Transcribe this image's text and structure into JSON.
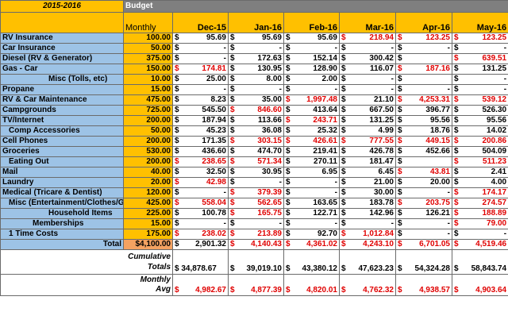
{
  "sheet": {
    "year_label": "2015-2016",
    "budget_label": "Budget",
    "monthly_label": "Monthly",
    "months": [
      "Dec-15",
      "Jan-16",
      "Feb-16",
      "Mar-16",
      "Apr-16",
      "May-16"
    ],
    "colors": {
      "header_yellow": "#ffc000",
      "label_blue": "#9dc3e6",
      "negative_red": "#e00000",
      "total_orange": "#f4a261",
      "budget_grey": "#7f7f7f"
    },
    "rows": [
      {
        "label": "RV Insurance",
        "indent": 0,
        "monthly": "100.00",
        "cells": [
          {
            "v": "95.69",
            "neg": false
          },
          {
            "v": "95.69",
            "neg": false
          },
          {
            "v": "95.69",
            "neg": false
          },
          {
            "v": "218.94",
            "neg": true
          },
          {
            "v": "123.25",
            "neg": true
          },
          {
            "v": "123.25",
            "neg": true
          }
        ]
      },
      {
        "label": "Car Insurance",
        "indent": 0,
        "monthly": "50.00",
        "cells": [
          {
            "v": "-",
            "neg": false
          },
          {
            "v": "-",
            "neg": false
          },
          {
            "v": "-",
            "neg": false
          },
          {
            "v": "-",
            "neg": false
          },
          {
            "v": "-",
            "neg": false
          },
          {
            "v": "-",
            "neg": false
          }
        ]
      },
      {
        "label": "Diesel (RV & Generator)",
        "indent": 0,
        "monthly": "375.00",
        "cells": [
          {
            "v": "-",
            "neg": false
          },
          {
            "v": "172.63",
            "neg": false
          },
          {
            "v": "152.14",
            "neg": false
          },
          {
            "v": "300.42",
            "neg": false
          },
          {
            "v": "",
            "neg": false
          },
          {
            "v": "639.51",
            "neg": true
          }
        ]
      },
      {
        "label": "Gas - Car",
        "indent": 0,
        "monthly": "150.00",
        "cells": [
          {
            "v": "174.81",
            "neg": true
          },
          {
            "v": "130.95",
            "neg": false
          },
          {
            "v": "128.90",
            "neg": false
          },
          {
            "v": "116.07",
            "neg": false
          },
          {
            "v": "187.16",
            "neg": true
          },
          {
            "v": "131.25",
            "neg": false
          }
        ]
      },
      {
        "label": "Misc (Tolls, etc)",
        "indent": 4,
        "monthly": "10.00",
        "cells": [
          {
            "v": "25.00",
            "neg": false
          },
          {
            "v": "8.00",
            "neg": false
          },
          {
            "v": "2.00",
            "neg": false
          },
          {
            "v": "-",
            "neg": false
          },
          {
            "v": "",
            "neg": false
          },
          {
            "v": "-",
            "neg": false
          }
        ]
      },
      {
        "label": "Propane",
        "indent": 0,
        "monthly": "15.00",
        "cells": [
          {
            "v": "-",
            "neg": false
          },
          {
            "v": "-",
            "neg": false
          },
          {
            "v": "-",
            "neg": false
          },
          {
            "v": "-",
            "neg": false
          },
          {
            "v": "-",
            "neg": false
          },
          {
            "v": "-",
            "neg": false
          }
        ]
      },
      {
        "label": "RV & Car Maintenance",
        "indent": 0,
        "monthly": "475.00",
        "cells": [
          {
            "v": "8.23",
            "neg": false
          },
          {
            "v": "35.00",
            "neg": false
          },
          {
            "v": "1,997.48",
            "neg": true
          },
          {
            "v": "21.10",
            "neg": false
          },
          {
            "v": "4,253.31",
            "neg": true
          },
          {
            "v": "539.12",
            "neg": true
          }
        ]
      },
      {
        "label": "Campgrounds",
        "indent": 0,
        "monthly": "725.00",
        "cells": [
          {
            "v": "545.50",
            "neg": false
          },
          {
            "v": "846.60",
            "neg": true
          },
          {
            "v": "413.64",
            "neg": false
          },
          {
            "v": "667.50",
            "neg": false
          },
          {
            "v": "396.77",
            "neg": false
          },
          {
            "v": "526.30",
            "neg": false
          }
        ]
      },
      {
        "label": "TV/Internet",
        "indent": 0,
        "monthly": "200.00",
        "cells": [
          {
            "v": "187.94",
            "neg": false
          },
          {
            "v": "113.66",
            "neg": false
          },
          {
            "v": "243.71",
            "neg": true
          },
          {
            "v": "131.25",
            "neg": false
          },
          {
            "v": "95.56",
            "neg": false
          },
          {
            "v": "95.56",
            "neg": false
          }
        ]
      },
      {
        "label": "Comp Accessories",
        "indent": 1,
        "monthly": "50.00",
        "cells": [
          {
            "v": "45.23",
            "neg": false
          },
          {
            "v": "36.08",
            "neg": false
          },
          {
            "v": "25.32",
            "neg": false
          },
          {
            "v": "4.99",
            "neg": false
          },
          {
            "v": "18.76",
            "neg": false
          },
          {
            "v": "14.02",
            "neg": false
          }
        ]
      },
      {
        "label": "Cell Phones",
        "indent": 0,
        "monthly": "200.00",
        "cells": [
          {
            "v": "171.35",
            "neg": false
          },
          {
            "v": "303.15",
            "neg": true
          },
          {
            "v": "426.61",
            "neg": true
          },
          {
            "v": "777.55",
            "neg": true
          },
          {
            "v": "449.15",
            "neg": true
          },
          {
            "v": "200.86",
            "neg": true
          }
        ]
      },
      {
        "label": "Groceries",
        "indent": 0,
        "monthly": "530.00",
        "cells": [
          {
            "v": "436.60",
            "neg": false
          },
          {
            "v": "474.70",
            "neg": false
          },
          {
            "v": "219.41",
            "neg": false
          },
          {
            "v": "426.78",
            "neg": false
          },
          {
            "v": "452.66",
            "neg": false
          },
          {
            "v": "504.09",
            "neg": false
          }
        ]
      },
      {
        "label": "Eating Out",
        "indent": 1,
        "monthly": "200.00",
        "cells": [
          {
            "v": "238.65",
            "neg": true
          },
          {
            "v": "571.34",
            "neg": true
          },
          {
            "v": "270.11",
            "neg": false
          },
          {
            "v": "181.47",
            "neg": false
          },
          {
            "v": "",
            "neg": false
          },
          {
            "v": "511.23",
            "neg": true
          }
        ]
      },
      {
        "label": "Mail",
        "indent": 0,
        "monthly": "40.00",
        "cells": [
          {
            "v": "32.50",
            "neg": false
          },
          {
            "v": "30.95",
            "neg": false
          },
          {
            "v": "6.95",
            "neg": false
          },
          {
            "v": "6.45",
            "neg": false
          },
          {
            "v": "43.81",
            "neg": true
          },
          {
            "v": "2.41",
            "neg": false
          }
        ]
      },
      {
        "label": "Laundry",
        "indent": 0,
        "monthly": "20.00",
        "cells": [
          {
            "v": "42.98",
            "neg": true
          },
          {
            "v": "-",
            "neg": false
          },
          {
            "v": "-",
            "neg": false
          },
          {
            "v": "21.00",
            "neg": false
          },
          {
            "v": "20.00",
            "neg": false
          },
          {
            "v": "4.00",
            "neg": false
          }
        ]
      },
      {
        "label": "Medical (Tricare & Dentist)",
        "indent": 0,
        "monthly": "120.00",
        "cells": [
          {
            "v": "-",
            "neg": false
          },
          {
            "v": "379.39",
            "neg": true
          },
          {
            "v": "-",
            "neg": false
          },
          {
            "v": "30.00",
            "neg": false
          },
          {
            "v": "-",
            "neg": false
          },
          {
            "v": "174.17",
            "neg": true
          }
        ]
      },
      {
        "label": "Misc (Entertainment/Clothes/G",
        "indent": 1,
        "monthly": "425.00",
        "cells": [
          {
            "v": "558.04",
            "neg": true
          },
          {
            "v": "562.65",
            "neg": true
          },
          {
            "v": "163.65",
            "neg": false
          },
          {
            "v": "183.78",
            "neg": false
          },
          {
            "v": "203.75",
            "neg": true
          },
          {
            "v": "274.57",
            "neg": true
          }
        ]
      },
      {
        "label": "Household Items",
        "indent": 4,
        "monthly": "225.00",
        "cells": [
          {
            "v": "100.78",
            "neg": false
          },
          {
            "v": "165.75",
            "neg": true
          },
          {
            "v": "122.71",
            "neg": false
          },
          {
            "v": "142.96",
            "neg": false
          },
          {
            "v": "126.21",
            "neg": false
          },
          {
            "v": "188.89",
            "neg": true
          }
        ]
      },
      {
        "label": "Memberships",
        "indent": 3,
        "monthly": "15.00",
        "cells": [
          {
            "v": "-",
            "neg": false
          },
          {
            "v": "-",
            "neg": false
          },
          {
            "v": "-",
            "neg": false
          },
          {
            "v": "-",
            "neg": false
          },
          {
            "v": "-",
            "neg": false
          },
          {
            "v": "79.00",
            "neg": true
          }
        ]
      },
      {
        "label": "1 Time Costs",
        "indent": 1,
        "monthly": "175.00",
        "cells": [
          {
            "v": "238.02",
            "neg": true
          },
          {
            "v": "213.89",
            "neg": true
          },
          {
            "v": "92.70",
            "neg": false
          },
          {
            "v": "1,012.84",
            "neg": true
          },
          {
            "v": "-",
            "neg": false
          },
          {
            "v": "-",
            "neg": false
          }
        ]
      }
    ],
    "total": {
      "label": "Total",
      "monthly": "$4,100.00",
      "cells": [
        {
          "v": "2,901.32",
          "neg": false
        },
        {
          "v": "4,140.43",
          "neg": true
        },
        {
          "v": "4,361.02",
          "neg": true
        },
        {
          "v": "4,243.10",
          "neg": true
        },
        {
          "v": "6,701.05",
          "neg": true
        },
        {
          "v": "4,519.46",
          "neg": true
        }
      ]
    },
    "cumulative": {
      "label_line1": "Cumulative",
      "label_line2": "Totals",
      "first": "$ 34,878.67",
      "cells": [
        {
          "v": "39,019.10",
          "neg": false
        },
        {
          "v": "43,380.12",
          "neg": false
        },
        {
          "v": "47,623.23",
          "neg": false
        },
        {
          "v": "54,324.28",
          "neg": false
        },
        {
          "v": "58,843.74",
          "neg": false
        }
      ]
    },
    "average": {
      "label_line1": "Monthly",
      "label_line2": "Avg",
      "cells": [
        {
          "v": "4,982.67",
          "neg": true
        },
        {
          "v": "4,877.39",
          "neg": true
        },
        {
          "v": "4,820.01",
          "neg": true
        },
        {
          "v": "4,762.32",
          "neg": true
        },
        {
          "v": "4,938.57",
          "neg": true
        },
        {
          "v": "4,903.64",
          "neg": true
        }
      ]
    },
    "currency_symbol": "$"
  }
}
